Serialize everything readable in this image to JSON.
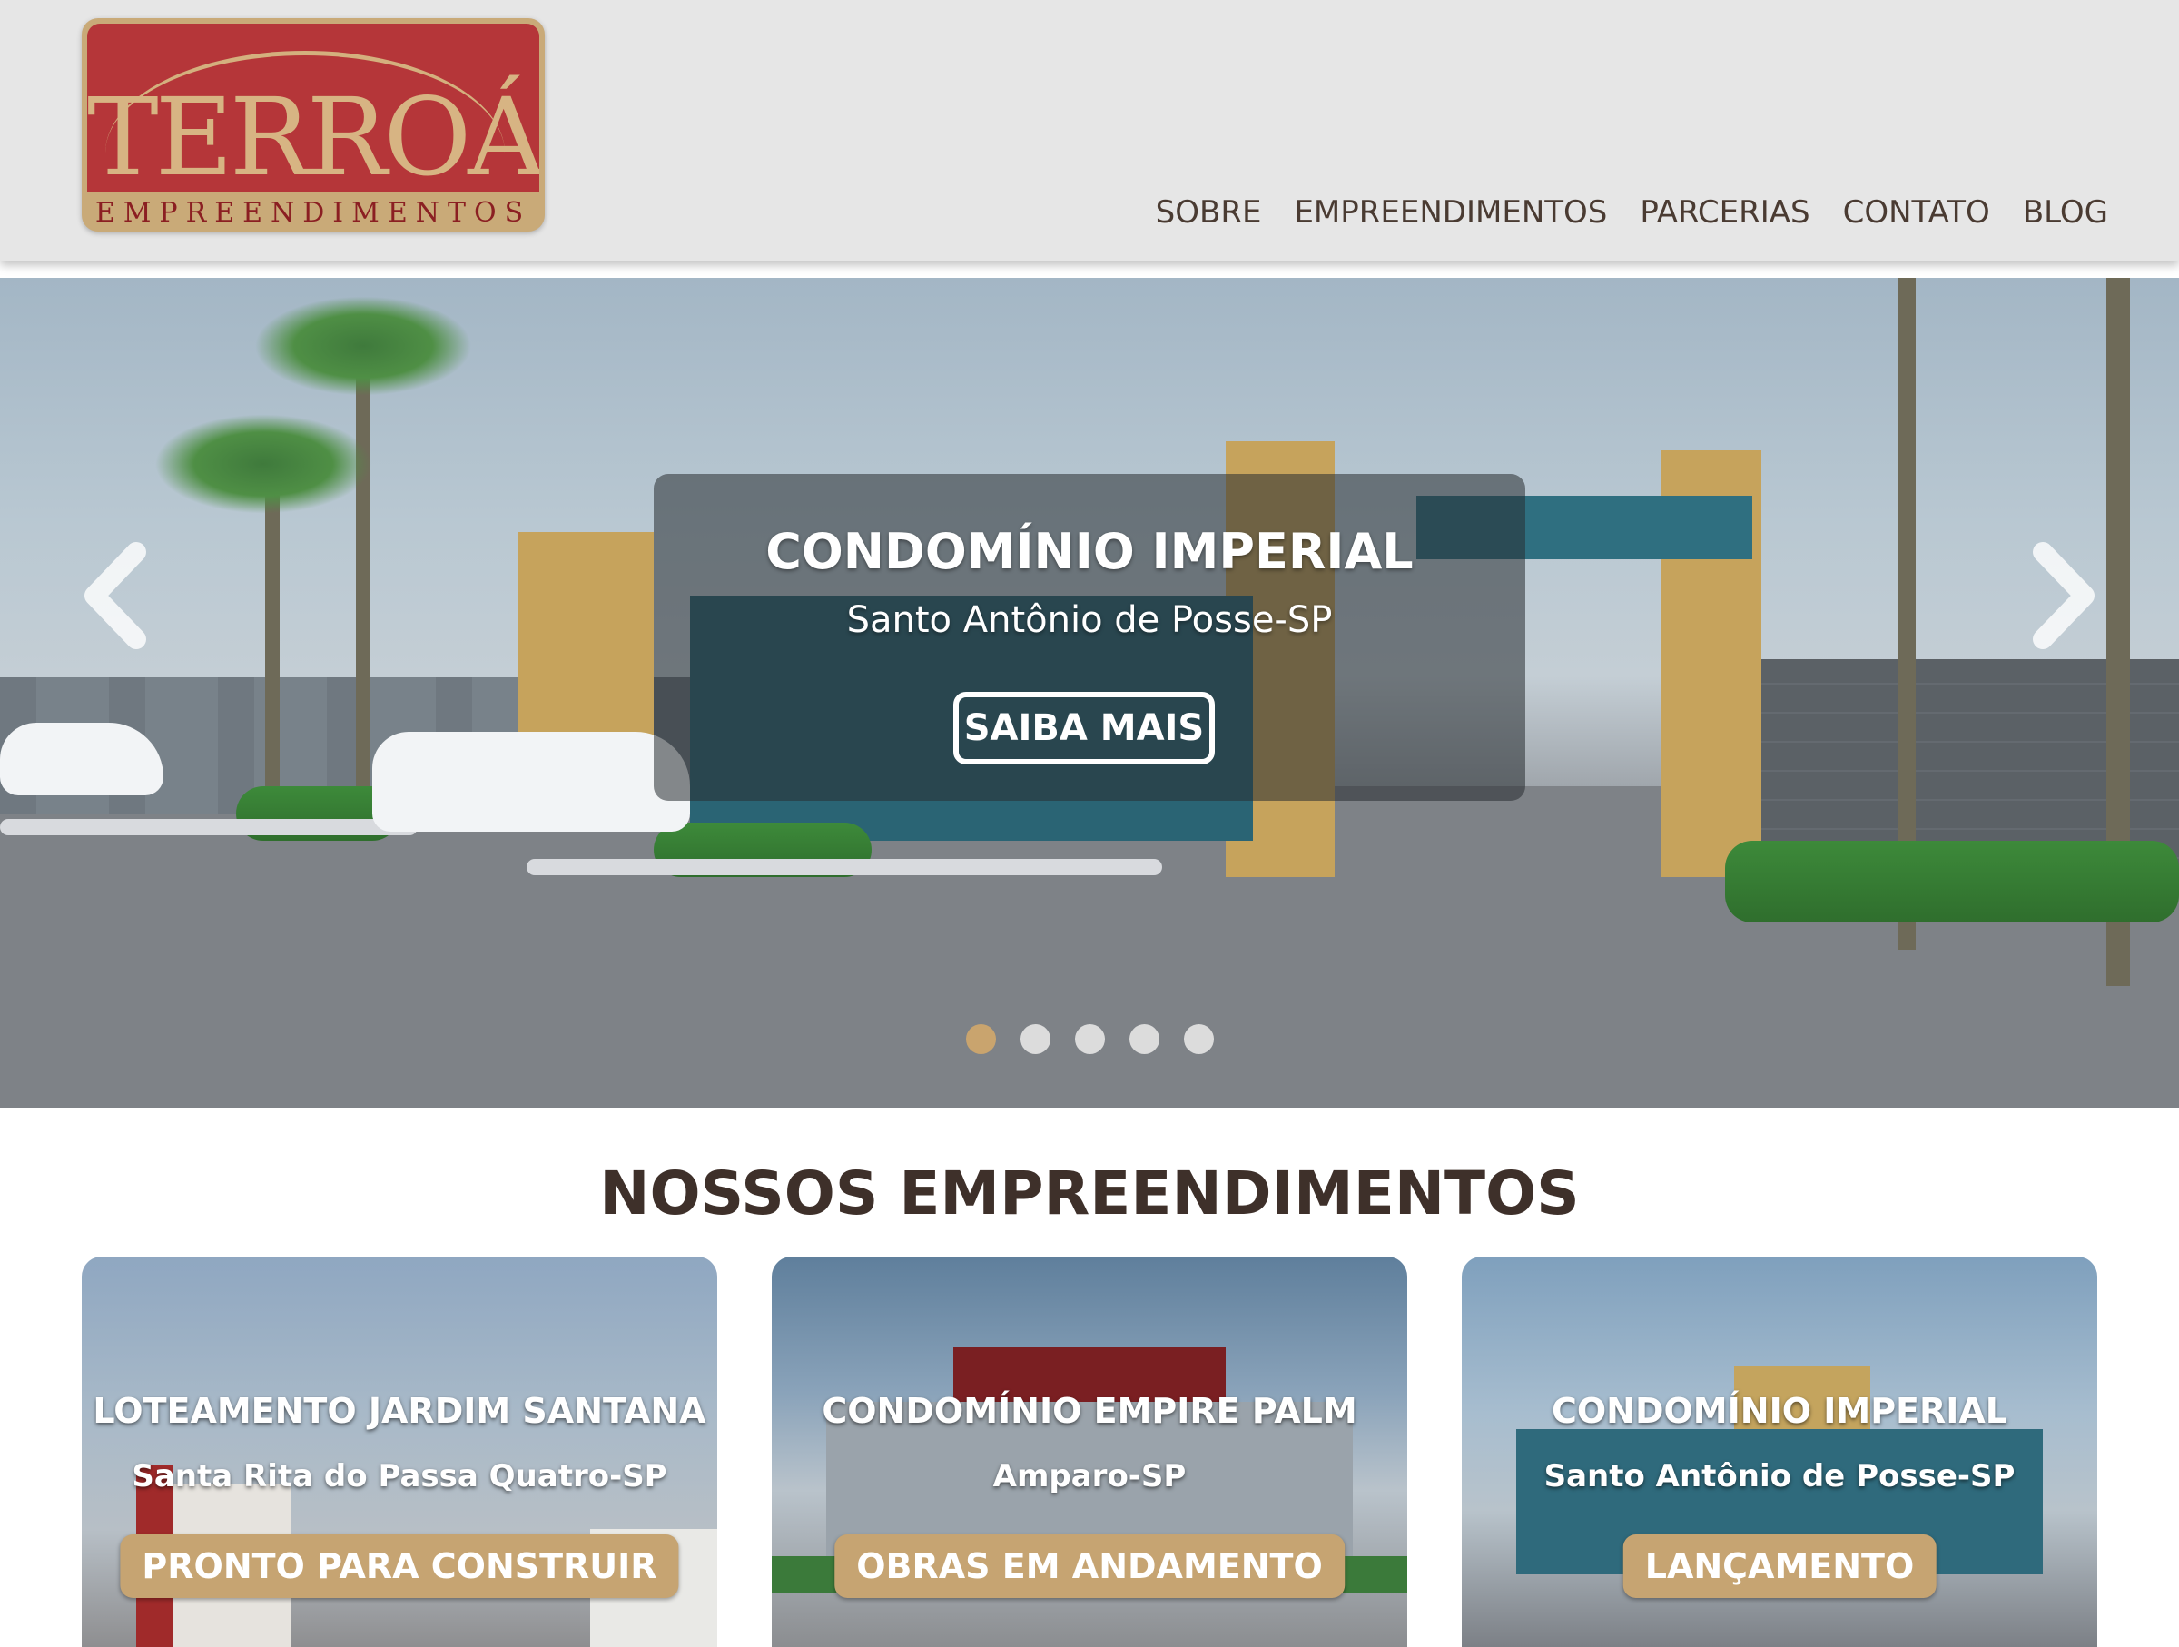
{
  "brand": {
    "name": "TERROÁ",
    "tagline": "EMPREENDIMENTOS"
  },
  "nav": {
    "items": [
      {
        "label": "SOBRE"
      },
      {
        "label": "EMPREENDIMENTOS"
      },
      {
        "label": "PARCERIAS"
      },
      {
        "label": "CONTATO"
      },
      {
        "label": "BLOG"
      }
    ]
  },
  "hero": {
    "title": "CONDOMÍNIO IMPERIAL",
    "subtitle": "Santo Antônio de Posse-SP",
    "button_label": "SAIBA MAIS",
    "slide_count": 5,
    "active_slide": 1,
    "prev_icon": "chevron-left-icon",
    "next_icon": "chevron-right-icon"
  },
  "section": {
    "title": "NOSSOS EMPREENDIMENTOS"
  },
  "cards": [
    {
      "title": "LOTEAMENTO JARDIM SANTANA",
      "location": "Santa Rita do Passa Quatro-SP",
      "status": "PRONTO PARA CONSTRUIR"
    },
    {
      "title": "CONDOMÍNIO EMPIRE PALM",
      "location": "Amparo-SP",
      "status": "OBRAS EM ANDAMENTO"
    },
    {
      "title": "CONDOMÍNIO IMPERIAL",
      "location": "Santo Antônio de Posse-SP",
      "status": "LANÇAMENTO"
    }
  ],
  "colors": {
    "logo_red": "#b53639",
    "logo_gold": "#c9aa78",
    "badge_gold": "#c6a472",
    "nav_text": "#4a3b32",
    "heading_text": "#3e302a",
    "dot_active": "#c9a46e",
    "dot_inactive": "#dcdcdc"
  }
}
